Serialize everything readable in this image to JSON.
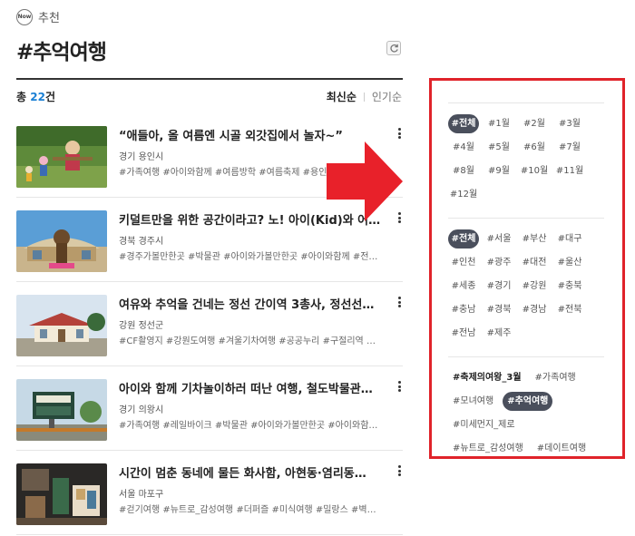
{
  "header": {
    "badge": "Now",
    "crumb": "추천",
    "title": "#추억여행"
  },
  "summary": {
    "prefix": "총",
    "count": "22",
    "suffix": "건",
    "sort_active": "최신순",
    "sort_inactive": "인기순"
  },
  "items": [
    {
      "title": "“애들아, 올 여름엔 시골 외갓집에서 놀자~”",
      "location": "경기 용인시",
      "tags": "#가족여행 #아이와함께 #여름방학 #여름축제 #용인가볼만한곳",
      "thumb": "scarecrow"
    },
    {
      "title": "키덜트만을 위한 공간이라고? 노! 아이(Kid)와 어른…",
      "location": "경북 경주시",
      "tags": "#경주가볼만한곳 #박물관 #아이와가볼만한곳 #아이와함께 #전시관 …",
      "thumb": "museum"
    },
    {
      "title": "여유와 추억을 건네는 정선 간이역 3총사, 정선선…",
      "location": "강원 정선군",
      "tags": "#CF촬영지 #강원도여행 #겨울기차여행 #공공누리 #구절리역 #국내…",
      "thumb": "station"
    },
    {
      "title": "아이와 함께 기차놀이하러 떠난 여행, 철도박물관…",
      "location": "경기 의왕시",
      "tags": "#가족여행 #레일바이크 #박물관 #아이와가볼만한곳 #아이와함께 #…",
      "thumb": "railway"
    },
    {
      "title": "시간이 멈춘 동네에 물든 화사함, 아현동·염리동…",
      "location": "서울 마포구",
      "tags": "#걷기여행 #뉴트로_감성여행 #더퍼즐 #미식여행 #밀랑스 #벽화 #부…",
      "thumb": "shop"
    }
  ],
  "filters": {
    "months": [
      "#전체",
      "#1월",
      "#2월",
      "#3월",
      "#4월",
      "#5월",
      "#6월",
      "#7월",
      "#8월",
      "#9월",
      "#10월",
      "#11월",
      "#12월"
    ],
    "months_selected": 0,
    "regions": [
      "#전체",
      "#서울",
      "#부산",
      "#대구",
      "#인천",
      "#광주",
      "#대전",
      "#울산",
      "#세종",
      "#경기",
      "#강원",
      "#충북",
      "#충남",
      "#경북",
      "#경남",
      "#전북",
      "#전남",
      "#제주"
    ],
    "regions_selected": 0,
    "themes": [
      "#축제의여왕_3월",
      "#가족여행",
      "#모녀여행",
      "#추억여행",
      "#미세먼지_제로",
      "#뉴트로_감성여행",
      "#데이트여행"
    ],
    "themes_selected": 3,
    "themes_bold": 0
  },
  "colors": {
    "accent": "#1a7fd4",
    "chip_selected": "#4a4f5c",
    "highlight_box": "#e0232a",
    "arrow": "#e8212a"
  },
  "icons": {
    "refresh": "refresh-icon",
    "more": "more-vertical-icon",
    "arrow": "arrow-right-icon"
  }
}
